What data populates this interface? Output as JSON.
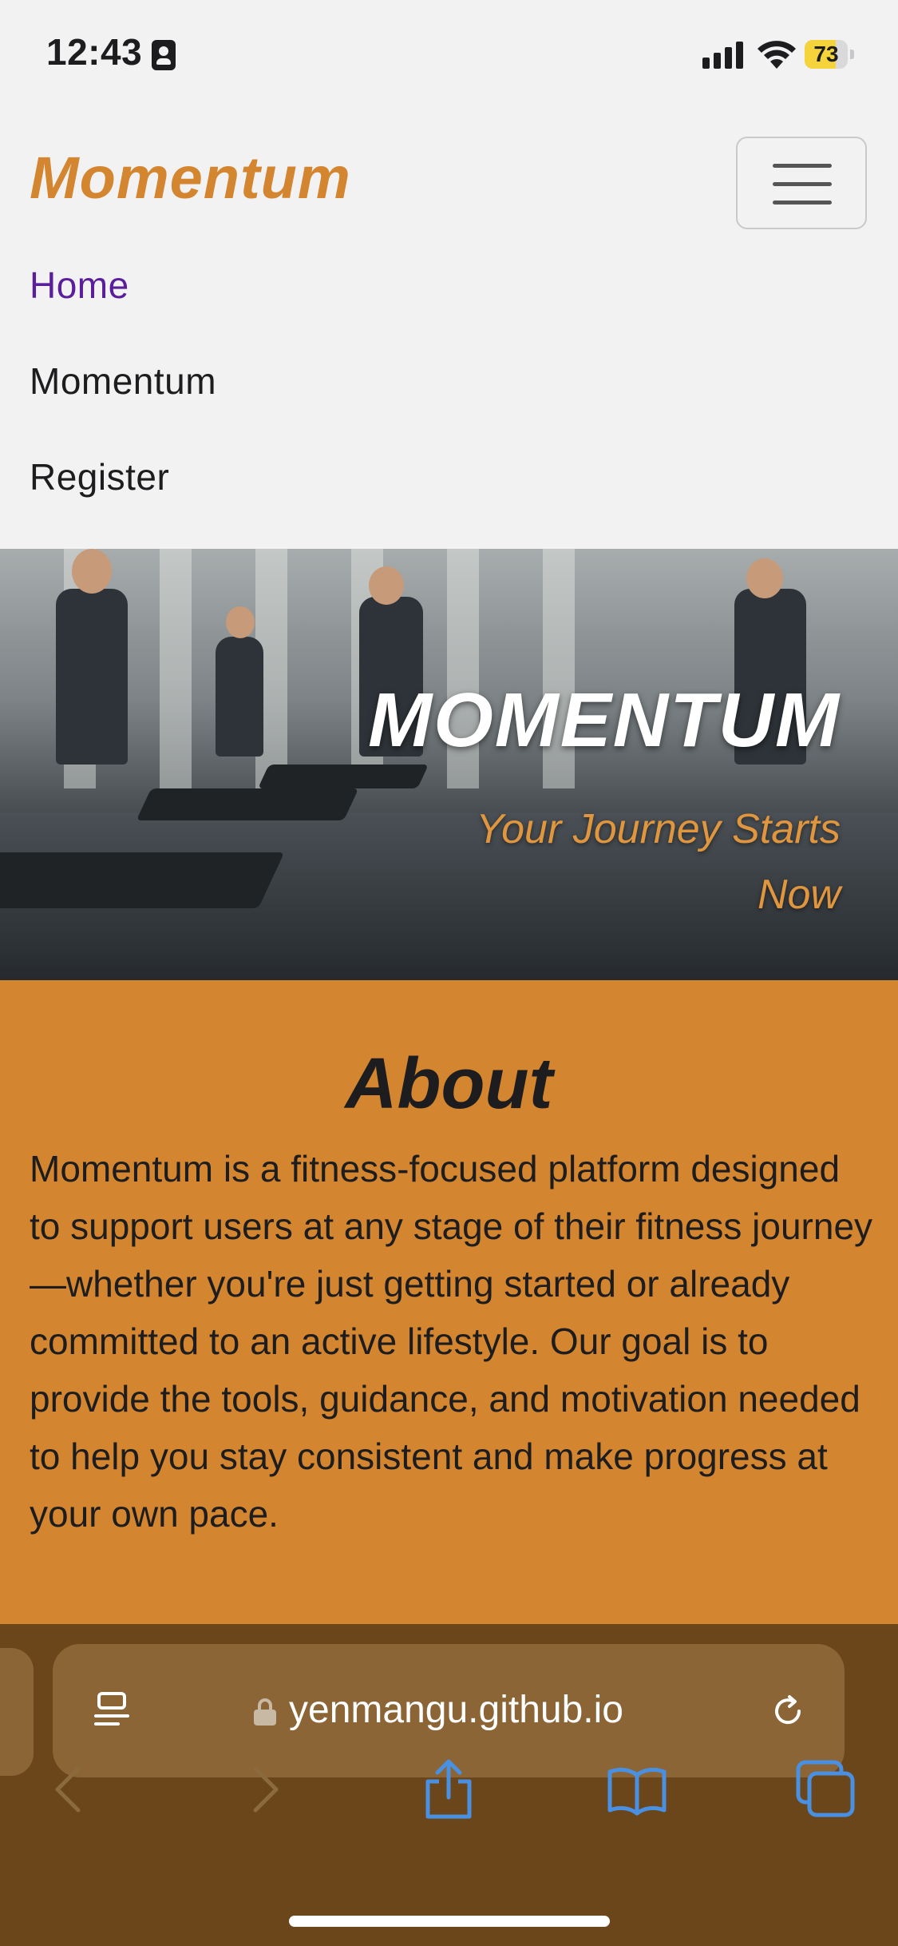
{
  "status_bar": {
    "time": "12:43",
    "battery_level": "73",
    "battery_fraction": 0.73
  },
  "navbar": {
    "brand": "Momentum",
    "links": [
      "Home",
      "Momentum",
      "Register"
    ],
    "active_link_color": "#5a1e9a",
    "brand_color": "#d4852f"
  },
  "hero": {
    "title": "MOMENTUM",
    "subtitle": "Your Journey Starts Now",
    "subtitle_color": "#e0963e"
  },
  "about": {
    "title": "About",
    "text": "Momentum is a fitness-focused platform designed to support users at any stage of their fitness journey—whether you're just getting started or already committed to an active lifestyle. Our goal is to provide the tools, guidance, and motivation needed to help you stay consistent and make progress at your own pace.",
    "background_color": "#d4852f"
  },
  "browser": {
    "url": "yenmangu.github.io",
    "icons": [
      "reader-icon",
      "lock-icon",
      "reload-icon",
      "back-icon",
      "forward-icon",
      "share-icon",
      "bookmarks-icon",
      "tabs-icon"
    ],
    "accent_color": "#4a90e2"
  }
}
